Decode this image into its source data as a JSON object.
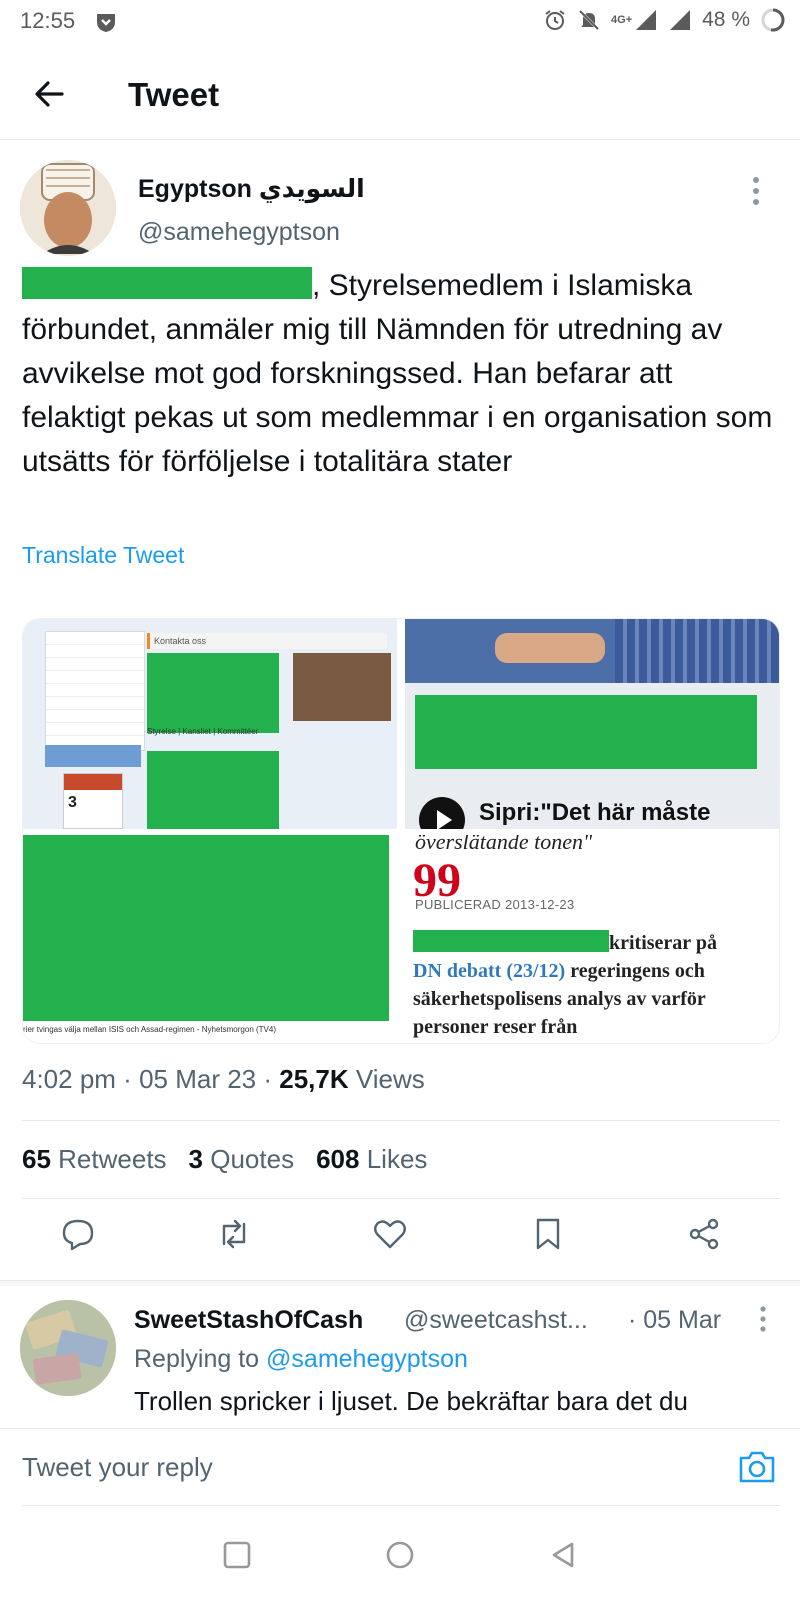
{
  "status_bar": {
    "time": "12:55",
    "network": "4G+",
    "battery": "48 %",
    "icons": [
      "shield-icon",
      "alarm-icon",
      "muted-bell-icon",
      "signal-icon",
      "battery-icon"
    ]
  },
  "header": {
    "title": "Tweet",
    "back_icon": "arrow-left-icon"
  },
  "tweet": {
    "author_name": "Egyptson السويدي",
    "author_handle": "@samehegyptson",
    "text_after_redaction": ", Styrelsemedlem i Islamiska förbundet, anmäler mig till Nämnden för utredning av avvikelse mot god forskningssed. Han befarar att felaktigt pekas ut som medlemmar i en organisation som utsätts för förföljelse i totalitära stater",
    "translate_label": "Translate Tweet",
    "media": {
      "tile1": {
        "header_label": "Kontakta oss",
        "tabs": "Styrelse | Kansliet | Kommittéer",
        "calendar_day": "3"
      },
      "tile2": {
        "caption": "Sipri:\"Det här måste"
      },
      "tile3": {
        "caption": "rier tvingas välja mellan ISIS och Assad-regimen - Nyhetsmorgon (TV4)"
      },
      "tile4": {
        "top_text": "överslätande tonen\"",
        "quote_mark": "99",
        "published": "PUBLICERAD 2013-12-23",
        "body_a": "kritiserar på",
        "body_link": "DN debatt (23/12)",
        "body_b": "regeringens och säkerhetspolisens analys av varför personer reser från"
      }
    },
    "time": "4:02 pm",
    "date": "05 Mar 23",
    "views_count": "25,7K",
    "views_label": "Views",
    "retweets_count": "65",
    "retweets_label": "Retweets",
    "quotes_count": "3",
    "quotes_label": "Quotes",
    "likes_count": "608",
    "likes_label": "Likes"
  },
  "reply": {
    "name": "SweetStashOfCash",
    "handle": "@sweetcashst...",
    "date": "· 05 Mar",
    "replying_prefix": "Replying to",
    "replying_to": "@samehegyptson",
    "text": "Trollen spricker i ljuset. De bekräftar bara det du"
  },
  "compose": {
    "placeholder": "Tweet your reply"
  },
  "colors": {
    "accent": "#1d9bf0",
    "redaction": "#22b14c",
    "text_primary": "#0f1419",
    "text_secondary": "#536471"
  }
}
